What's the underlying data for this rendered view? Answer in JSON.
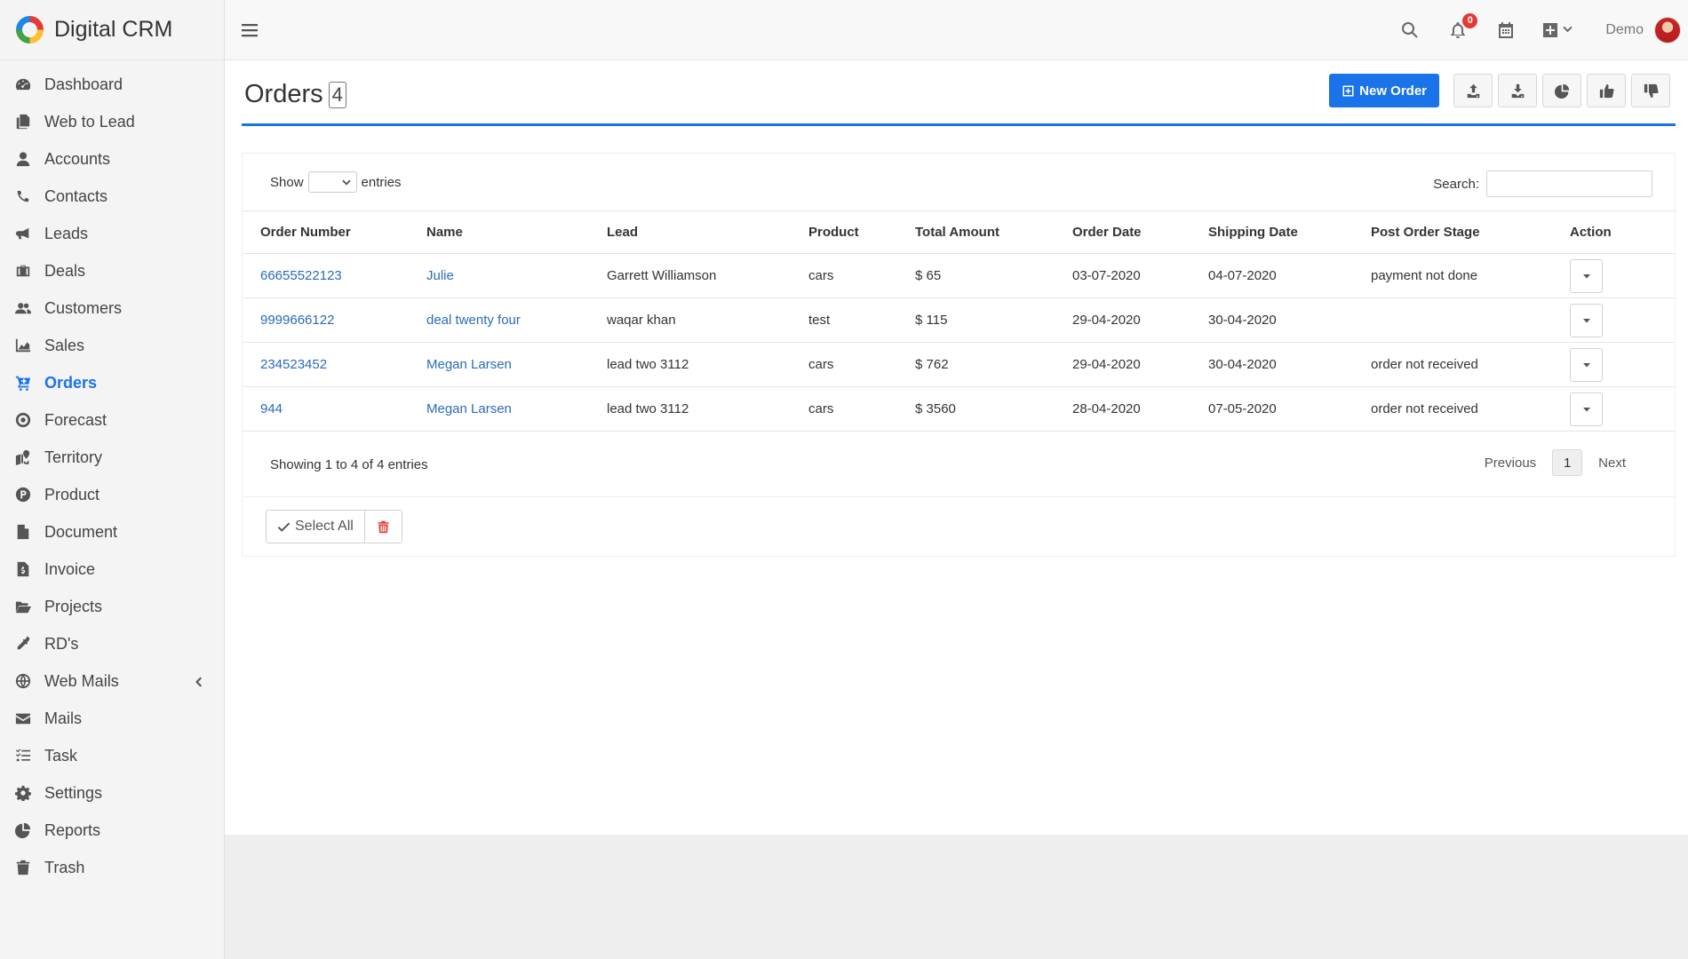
{
  "app": {
    "name": "Digital CRM"
  },
  "sidebar": {
    "items": [
      {
        "label": "Dashboard",
        "icon": "dashboard-icon"
      },
      {
        "label": "Web to Lead",
        "icon": "copy-icon"
      },
      {
        "label": "Accounts",
        "icon": "user-icon"
      },
      {
        "label": "Contacts",
        "icon": "phone-icon"
      },
      {
        "label": "Leads",
        "icon": "bullhorn-icon"
      },
      {
        "label": "Deals",
        "icon": "briefcase-icon"
      },
      {
        "label": "Customers",
        "icon": "users-icon"
      },
      {
        "label": "Sales",
        "icon": "area-chart-icon"
      },
      {
        "label": "Orders",
        "icon": "cart-icon",
        "active": true
      },
      {
        "label": "Forecast",
        "icon": "target-icon"
      },
      {
        "label": "Territory",
        "icon": "map-icon"
      },
      {
        "label": "Product",
        "icon": "product-icon"
      },
      {
        "label": "Document",
        "icon": "document-icon"
      },
      {
        "label": "Invoice",
        "icon": "invoice-icon"
      },
      {
        "label": "Projects",
        "icon": "folder-open-icon"
      },
      {
        "label": "RD's",
        "icon": "eyedropper-icon"
      },
      {
        "label": "Web Mails",
        "icon": "globe-icon"
      },
      {
        "label": "Mails",
        "icon": "envelope-icon"
      },
      {
        "label": "Task",
        "icon": "tasks-icon"
      },
      {
        "label": "Settings",
        "icon": "gear-icon"
      },
      {
        "label": "Reports",
        "icon": "pie-chart-icon"
      },
      {
        "label": "Trash",
        "icon": "trash-icon"
      }
    ]
  },
  "topbar": {
    "notification_count": "0",
    "user_name": "Demo"
  },
  "page": {
    "title": "Orders",
    "count": "4",
    "new_button": "New Order"
  },
  "table_controls": {
    "show_label": "Show",
    "entries_label": "entries",
    "search_label": "Search:"
  },
  "table": {
    "columns": [
      "Order Number",
      "Name",
      "Lead",
      "Product",
      "Total Amount",
      "Order Date",
      "Shipping Date",
      "Post Order Stage",
      "Action"
    ],
    "rows": [
      {
        "order_number": "66655522123",
        "name": "Julie",
        "lead": "Garrett Williamson",
        "product": "cars",
        "total": "$ 65",
        "order_date": "03-07-2020",
        "shipping_date": "04-07-2020",
        "stage": "payment not done"
      },
      {
        "order_number": "9999666122",
        "name": "deal twenty four",
        "lead": "waqar khan",
        "product": "test",
        "total": "$ 115",
        "order_date": "29-04-2020",
        "shipping_date": "30-04-2020",
        "stage": ""
      },
      {
        "order_number": "234523452",
        "name": "Megan Larsen",
        "lead": "lead two 3112",
        "product": "cars",
        "total": "$ 762",
        "order_date": "29-04-2020",
        "shipping_date": "30-04-2020",
        "stage": "order not received"
      },
      {
        "order_number": "944",
        "name": "Megan Larsen",
        "lead": "lead two 3112",
        "product": "cars",
        "total": "$ 3560",
        "order_date": "28-04-2020",
        "shipping_date": "07-05-2020",
        "stage": "order not received"
      }
    ]
  },
  "footer": {
    "info": "Showing 1 to 4 of 4 entries",
    "previous": "Previous",
    "page": "1",
    "next": "Next",
    "select_all": "Select All"
  },
  "colors": {
    "accent": "#1a73e8",
    "link": "#2a6bb8",
    "danger": "#e53935"
  }
}
